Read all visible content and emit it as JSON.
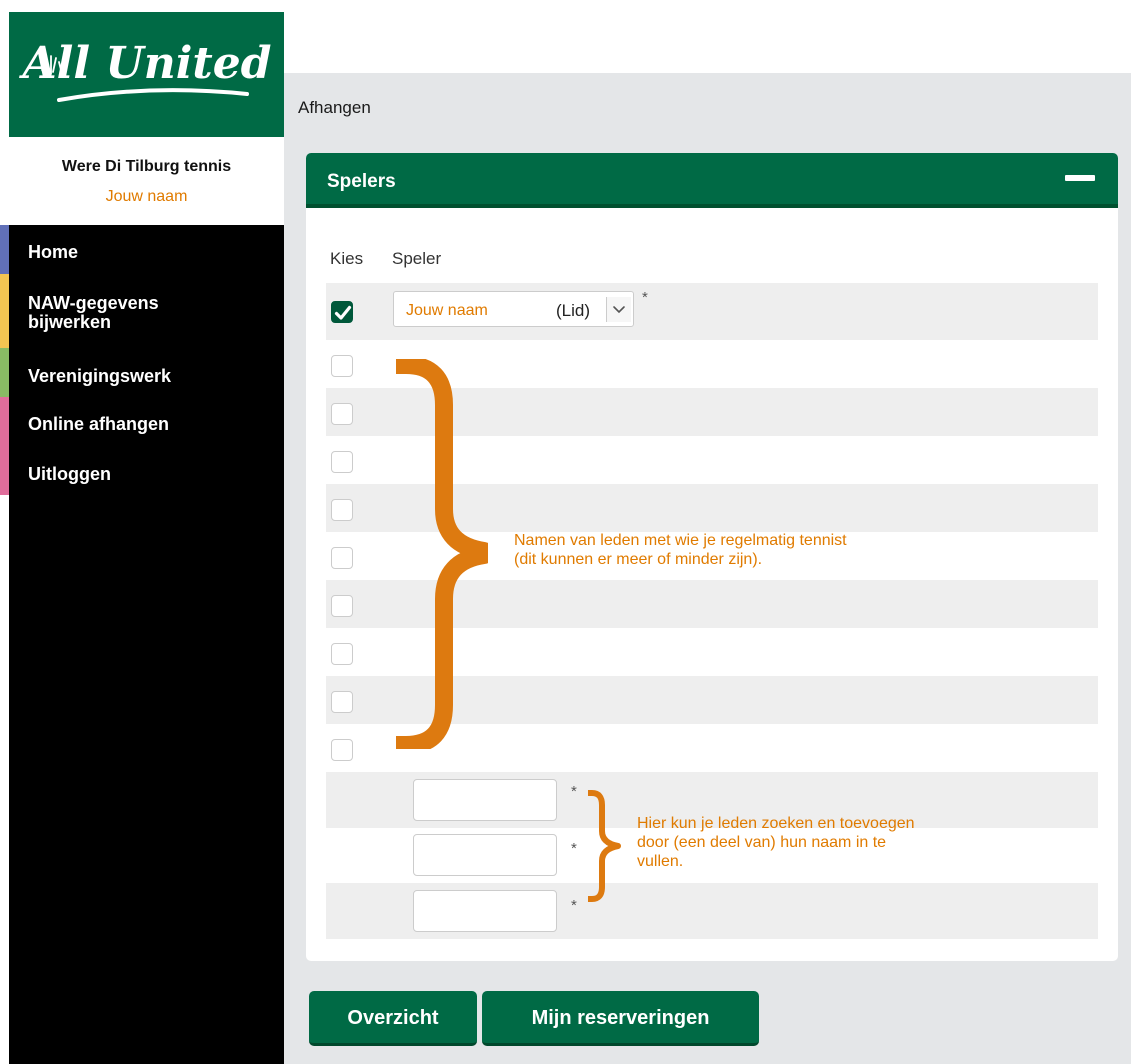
{
  "brand": {
    "logo_text": "All United",
    "org_name": "Were Di Tilburg tennis",
    "user_name": "Jouw naam"
  },
  "colors": {
    "brand_green": "#006a45",
    "accent_orange": "#e07b00",
    "sidebar_bg": "#000000"
  },
  "nav": {
    "items": [
      {
        "label": "Home",
        "strip_color": "#6170b8"
      },
      {
        "label": "NAW-gegevens bijwerken",
        "strip_color": "#f3c552"
      },
      {
        "label": "Verenigingswerk",
        "strip_color": "#89bb64"
      },
      {
        "label": "Online afhangen",
        "strip_color": "#e06d9b"
      },
      {
        "label": "Uitloggen",
        "strip_color": "#e06d9b"
      }
    ]
  },
  "page": {
    "title": "Afhangen"
  },
  "panel": {
    "title": "Spelers",
    "columns": {
      "choose": "Kies",
      "player": "Speler"
    },
    "selected_player": {
      "name": "Jouw naam",
      "type": "(Lid)"
    },
    "required_mark": "*",
    "player_checkboxes_checked": [
      true,
      false,
      false,
      false,
      false,
      false,
      false,
      false,
      false,
      false
    ],
    "search_fields": [
      {
        "value": "",
        "placeholder": ""
      },
      {
        "value": "",
        "placeholder": ""
      },
      {
        "value": "",
        "placeholder": ""
      }
    ]
  },
  "annotations": {
    "members_line1": "Namen van leden met wie je regelmatig tennist",
    "members_line2": "(dit kunnen er meer of minder zijn).",
    "search_line1": "Hier kun je leden zoeken en toevoegen",
    "search_line2": "door (een deel van) hun naam in te",
    "search_line3": "vullen."
  },
  "buttons": {
    "overview": "Overzicht",
    "my_reservations": "Mijn reserveringen"
  }
}
